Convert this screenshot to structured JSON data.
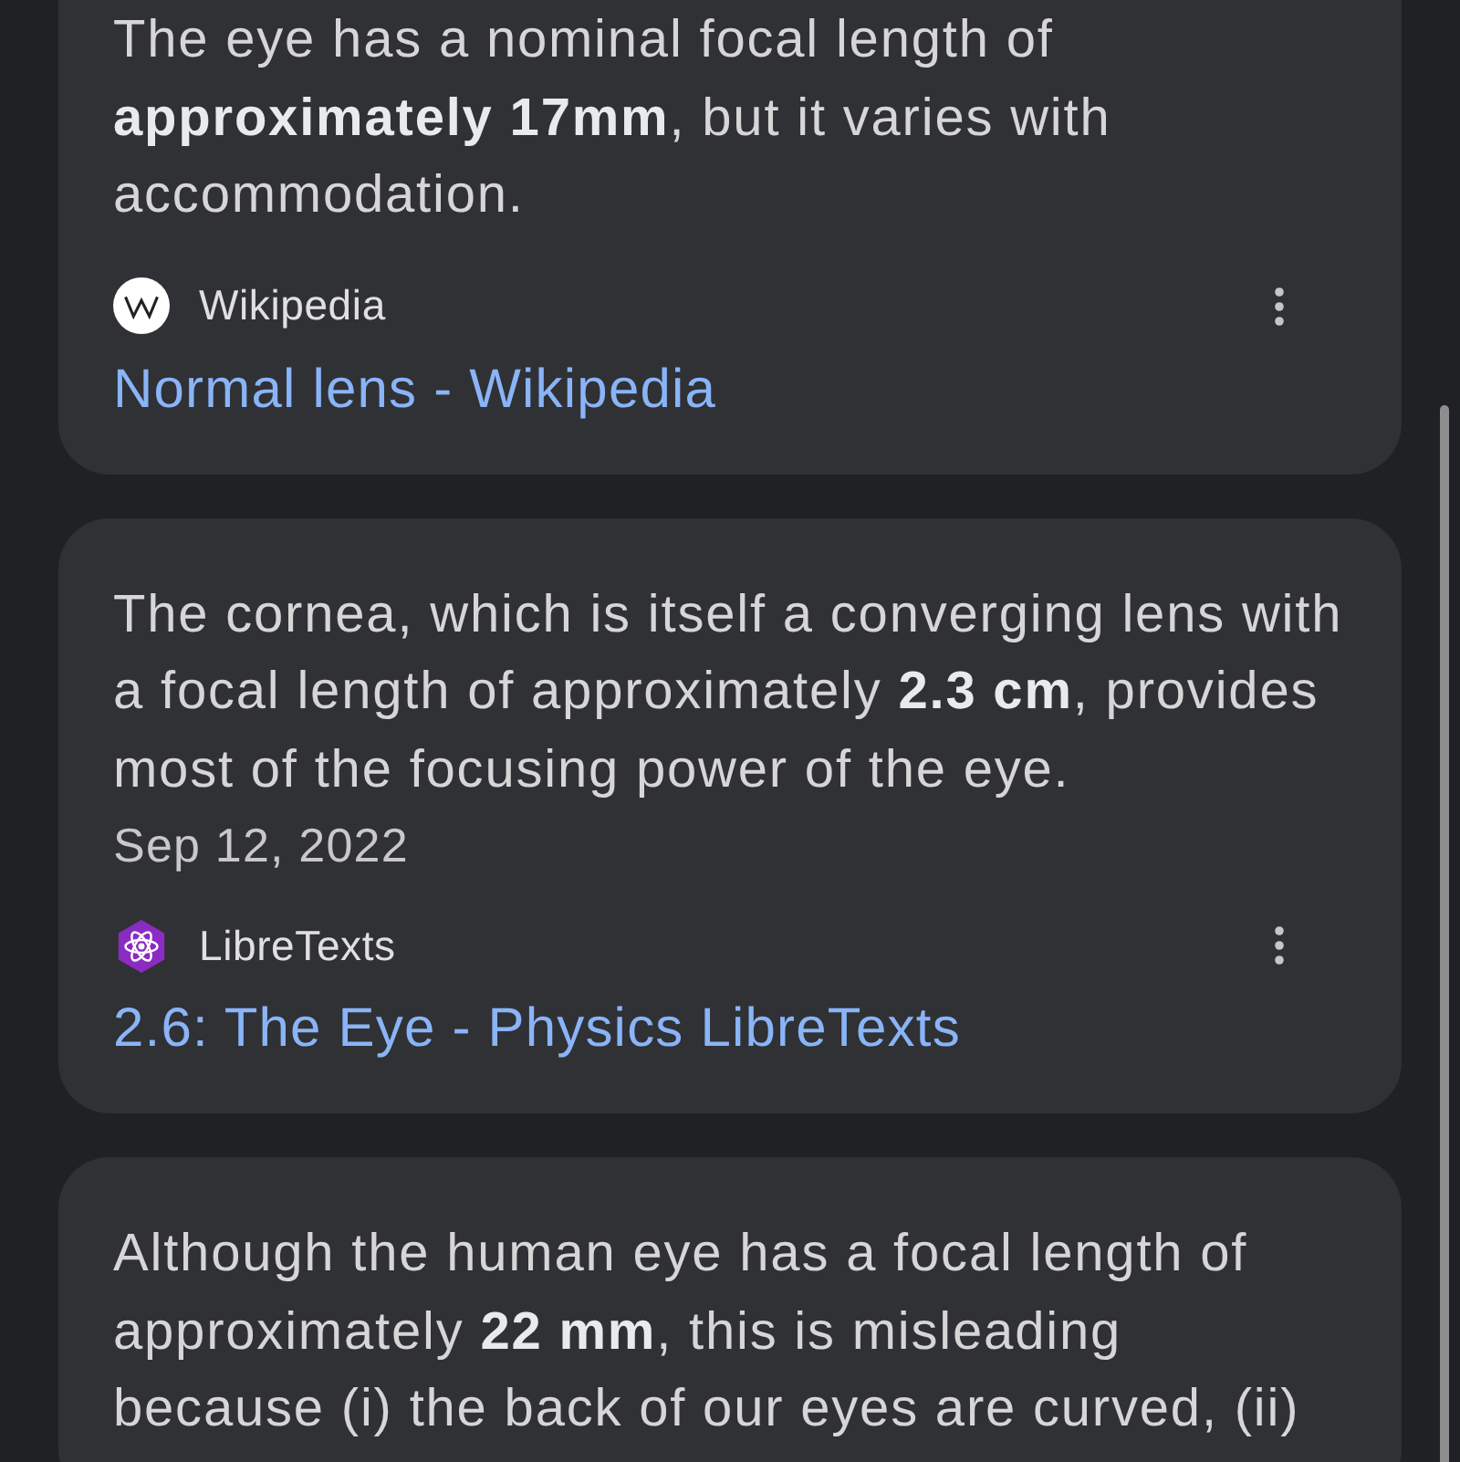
{
  "results": [
    {
      "snippet": "The eye has a nominal focal length of **approximately 17mm**, but it varies with accommodation.",
      "source": {
        "name": "Wikipedia"
      },
      "link": "Normal lens - Wikipedia"
    },
    {
      "snippet": "The cornea, which is itself a converging lens with a focal length of approximately **2.3 cm**, provides most of the focusing power of the eye.",
      "date": "Sep 12, 2022",
      "source": {
        "name": "LibreTexts"
      },
      "link": "2.6: The Eye - Physics LibreTexts"
    },
    {
      "snippet": "Although the human eye has a focal length of approximately **22 mm**, this is misleading because (i) the back of our eyes are curved, (ii)"
    }
  ]
}
